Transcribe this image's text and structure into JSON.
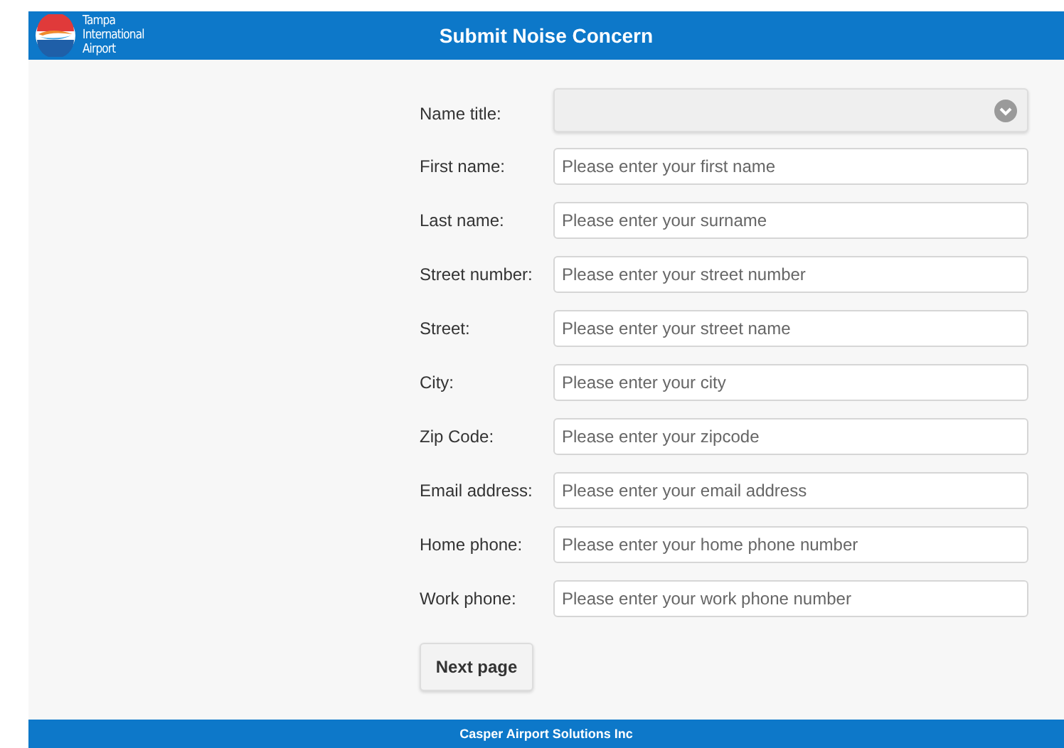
{
  "header": {
    "logo_text": [
      "Tampa",
      "International",
      "Airport"
    ],
    "title": "Submit Noise Concern"
  },
  "form": {
    "select": {
      "label": "Name title:"
    },
    "fields": [
      {
        "label": "First name:",
        "placeholder": "Please enter your first name"
      },
      {
        "label": "Last name:",
        "placeholder": "Please enter your surname"
      },
      {
        "label": "Street number:",
        "placeholder": "Please enter your street number"
      },
      {
        "label": "Street:",
        "placeholder": "Please enter your street name"
      },
      {
        "label": "City:",
        "placeholder": "Please enter your city"
      },
      {
        "label": "Zip Code:",
        "placeholder": "Please enter your zipcode"
      },
      {
        "label": "Email address:",
        "placeholder": "Please enter your email address"
      },
      {
        "label": "Home phone:",
        "placeholder": "Please enter your home phone number"
      },
      {
        "label": "Work phone:",
        "placeholder": "Please enter your work phone number"
      }
    ],
    "button": "Next page"
  },
  "footer": "Casper Airport Solutions Inc"
}
